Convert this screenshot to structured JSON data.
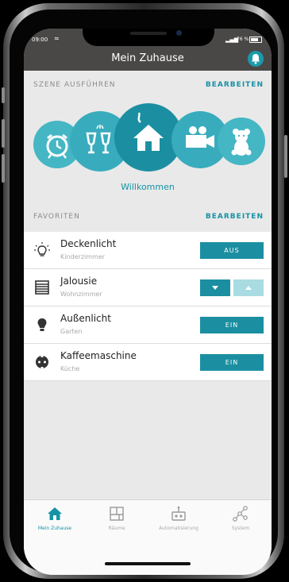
{
  "status": {
    "time": "09:00",
    "battery": "76 %"
  },
  "header": {
    "title": "Mein Zuhause"
  },
  "scenes": {
    "section_label": "SZENE AUSFÜHREN",
    "edit_label": "BEARBEITEN",
    "selected_label": "Willkommen",
    "items": [
      {
        "icon": "alarm-clock-icon"
      },
      {
        "icon": "wine-glasses-icon"
      },
      {
        "icon": "home-icon"
      },
      {
        "icon": "video-camera-icon"
      },
      {
        "icon": "teddy-bear-icon"
      }
    ]
  },
  "favorites": {
    "section_label": "FAVORITEN",
    "edit_label": "BEARBEITEN",
    "items": [
      {
        "name": "Deckenlicht",
        "room": "Kinderzimmer",
        "button": "AUS",
        "icon": "ceiling-light-icon"
      },
      {
        "name": "Jalousie",
        "room": "Wohnzimmer",
        "icon": "blinds-icon"
      },
      {
        "name": "Außenlicht",
        "room": "Garten",
        "button": "EIN",
        "icon": "bulb-icon"
      },
      {
        "name": "Kaffeemaschine",
        "room": "Küche",
        "button": "EIN",
        "icon": "plug-icon"
      }
    ]
  },
  "tabs": [
    {
      "label": "Mein Zuhause",
      "active": true
    },
    {
      "label": "Räume"
    },
    {
      "label": "Automatisierung"
    },
    {
      "label": "System"
    }
  ],
  "colors": {
    "accent": "#1593a6",
    "header": "#4a4846",
    "scene_circle": "#3cb2c1",
    "scene_active": "#1b8fa1"
  }
}
